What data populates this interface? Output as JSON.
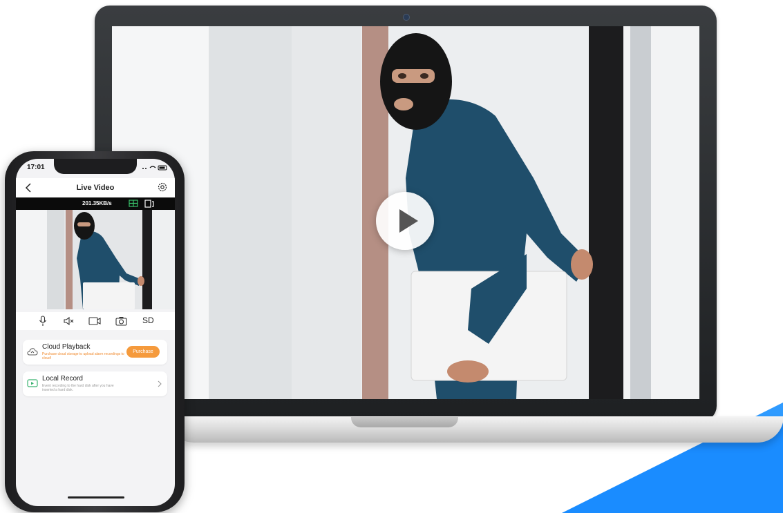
{
  "phone": {
    "status_time": "17:01",
    "nav_title": "Live Video",
    "bitrate": "201.35KB/s",
    "quality": "SD",
    "cloud_playback": {
      "title": "Cloud Playback",
      "subtitle": "Purchase cloud storage to upload alarm recordings to cloud!",
      "button": "Purchase"
    },
    "local_record": {
      "title": "Local Record",
      "subtitle": "Event recording to the hard disk after you have inserted a hard disk."
    }
  },
  "colors": {
    "accent_blue": "#1a8cff",
    "purchase_orange": "#f59a3c",
    "hoodie_blue": "#1f4e6b"
  },
  "icons": [
    "play-icon",
    "back-icon",
    "settings-icon",
    "grid-icon",
    "screen-switch-icon",
    "microphone-icon",
    "mute-icon",
    "record-icon",
    "camera-icon",
    "cloud-icon",
    "local-record-icon",
    "chevron-right-icon"
  ]
}
